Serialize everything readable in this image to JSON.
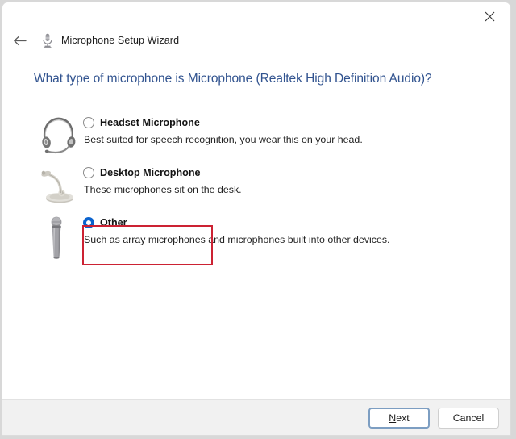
{
  "window": {
    "title": "Microphone Setup Wizard",
    "close_label": "✕",
    "back_label": "←"
  },
  "heading": "What type of microphone is Microphone (Realtek High Definition Audio)?",
  "options": [
    {
      "id": "headset",
      "icon": "headset-microphone-icon",
      "title": "Headset Microphone",
      "description": "Best suited for speech recognition, you wear this on your head.",
      "selected": false
    },
    {
      "id": "desktop",
      "icon": "desktop-microphone-icon",
      "title": "Desktop Microphone",
      "description": "These microphones sit on the desk.",
      "selected": false
    },
    {
      "id": "other",
      "icon": "handheld-microphone-icon",
      "title": "Other",
      "description": "Such as array microphones and microphones built into other devices.",
      "selected": true
    }
  ],
  "footer": {
    "next_accel": "N",
    "next_rest": "ext",
    "cancel_label": "Cancel"
  },
  "colors": {
    "heading": "#31538f",
    "accent_radio": "#0b63ce",
    "highlight_box": "#cc2233",
    "footer_bg": "#f1f1f1",
    "focus_ring": "#7d9ec2"
  }
}
